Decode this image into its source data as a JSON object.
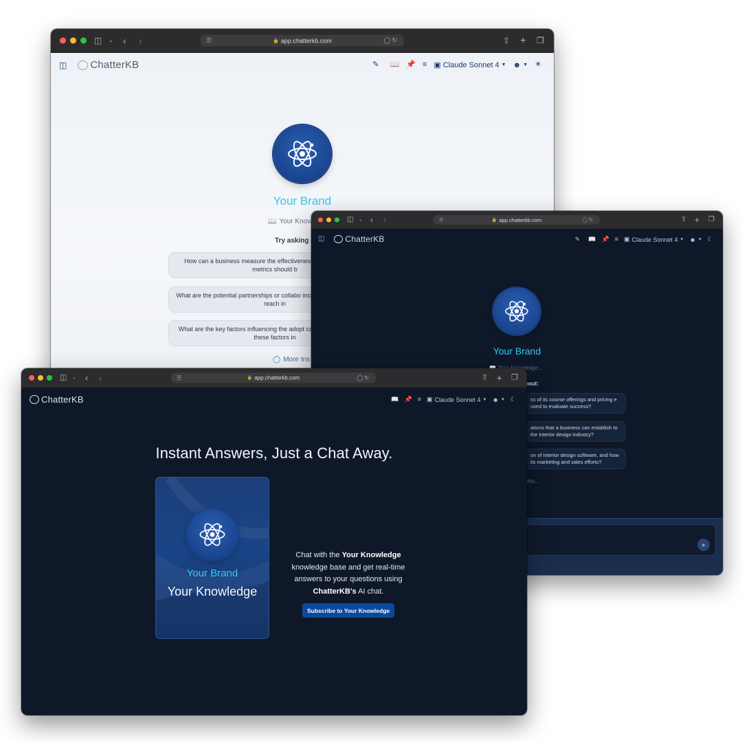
{
  "browser": {
    "url": "app.chatterkb.com"
  },
  "app": {
    "logo_main": "Chatter",
    "logo_kb": "KB",
    "model": "Claude Sonnet 4"
  },
  "light_window": {
    "brand": "Your Brand",
    "kb_line": "Your Know",
    "try_asking": "Try asking a",
    "questions": [
      "How can a business measure the effectiveness strategy, and what metrics should b",
      "What are the potential partnerships or collabo increase its credibility and reach in",
      "What are the key factors influencing the adopt can a business address these factors in"
    ],
    "more": "More Ins"
  },
  "dark_chat_window": {
    "brand": "Your Brand",
    "kb_line": "Your Knowledge...",
    "about": "bout:",
    "questions": [
      "ss of its course offerings and pricing e used to evaluate success?",
      "ations that a business can establish to the interior design industry?",
      "on of interior design software, and how its marketing and sales efforts?"
    ],
    "more": "ghts..."
  },
  "landing_window": {
    "headline": "Instant Answers, Just a Chat Away.",
    "card_brand": "Your Brand",
    "card_name": "Your Knowledge",
    "desc_1": "Chat with the ",
    "desc_kb": "Your Knowledge",
    "desc_2": " knowledge base and get real-time answers to your questions using ",
    "desc_brand": "ChatterKB's",
    "desc_3": " AI chat.",
    "cta": "Subscribe to Your Knowledge"
  },
  "colors": {
    "accent_cyan": "#33c6f0",
    "dark_bg": "#0e1829",
    "cta_blue": "#0a4a9c",
    "orb_blue": "#1d4a96"
  }
}
